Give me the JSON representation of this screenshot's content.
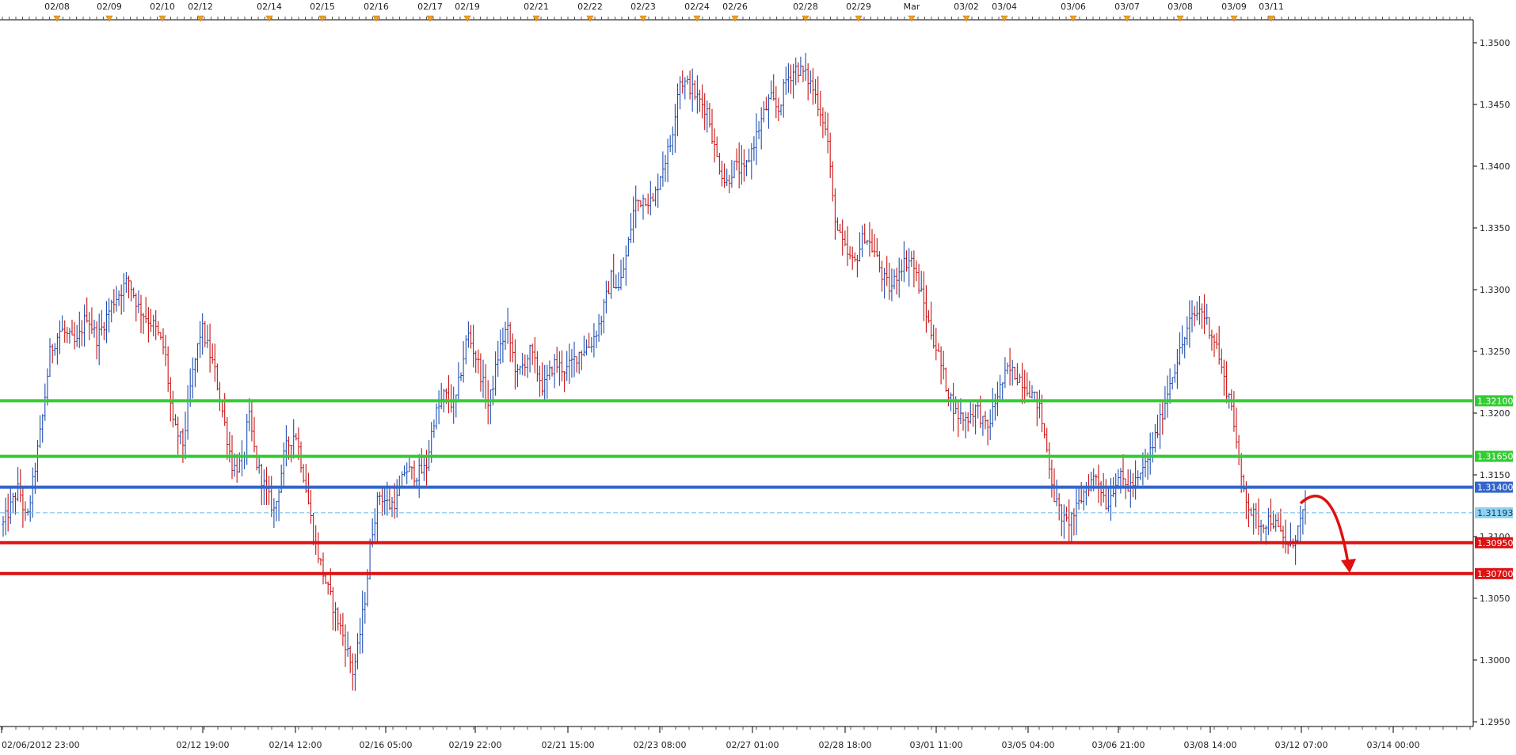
{
  "chart_data": {
    "type": "candlestick",
    "top_date_labels": [
      "02/08",
      "02/09",
      "02/10",
      "02/12",
      "02/14",
      "02/15",
      "02/16",
      "02/17",
      "02/19",
      "02/21",
      "02/22",
      "02/23",
      "02/24",
      "02/26",
      "02/28",
      "02/29",
      "Mar",
      "03/02",
      "03/04",
      "03/06",
      "03/07",
      "03/08",
      "03/09",
      "03/11"
    ],
    "x_tick_labels": [
      "02/06/2012 23:00",
      "02/12 19:00",
      "02/14 12:00",
      "02/16 05:00",
      "02/19 22:00",
      "02/21 15:00",
      "02/23 08:00",
      "02/27 01:00",
      "02/28 18:00",
      "03/01 11:00",
      "03/05 04:00",
      "03/06 21:00",
      "03/08 14:00",
      "03/12 07:00",
      "03/14 00:00"
    ],
    "y_ticks": [
      1.295,
      1.3,
      1.305,
      1.31,
      1.315,
      1.32,
      1.325,
      1.33,
      1.335,
      1.34,
      1.345,
      1.35
    ],
    "y_tick_labels": [
      "1.2950",
      "1.3000",
      "1.3050",
      "1.3100",
      "1.3150",
      "1.3200",
      "1.3250",
      "1.3300",
      "1.3350",
      "1.3400",
      "1.3450",
      "1.3500"
    ],
    "ylim": [
      1.2945,
      1.3503
    ],
    "grid": false,
    "current_price": {
      "value": 1.31193,
      "label": "1.31193",
      "color": "#8fd3f4"
    },
    "horizontal_levels": [
      {
        "value": 1.321,
        "label": "1.32100",
        "color": "#33cc33"
      },
      {
        "value": 1.3165,
        "label": "1.31650",
        "color": "#33cc33"
      },
      {
        "value": 1.314,
        "label": "1.31400",
        "color": "#3366cc"
      },
      {
        "value": 1.3095,
        "label": "1.30950",
        "color": "#dd1111"
      },
      {
        "value": 1.307,
        "label": "1.30700",
        "color": "#dd1111"
      }
    ],
    "price_path": [
      [
        0,
        1.311
      ],
      [
        6,
        1.314
      ],
      [
        9,
        1.311
      ],
      [
        15,
        1.3195
      ],
      [
        18,
        1.325
      ],
      [
        22,
        1.3268
      ],
      [
        28,
        1.3255
      ],
      [
        32,
        1.328
      ],
      [
        36,
        1.326
      ],
      [
        42,
        1.329
      ],
      [
        48,
        1.3308
      ],
      [
        52,
        1.3285
      ],
      [
        58,
        1.327
      ],
      [
        62,
        1.325
      ],
      [
        65,
        1.319
      ],
      [
        69,
        1.3175
      ],
      [
        72,
        1.3225
      ],
      [
        76,
        1.327
      ],
      [
        81,
        1.3235
      ],
      [
        85,
        1.319
      ],
      [
        88,
        1.3155
      ],
      [
        92,
        1.316
      ],
      [
        94,
        1.32
      ],
      [
        97,
        1.316
      ],
      [
        101,
        1.3135
      ],
      [
        104,
        1.312
      ],
      [
        108,
        1.317
      ],
      [
        112,
        1.3185
      ],
      [
        116,
        1.314
      ],
      [
        119,
        1.31
      ],
      [
        122,
        1.3075
      ],
      [
        124,
        1.306
      ],
      [
        127,
        1.304
      ],
      [
        131,
        1.3015
      ],
      [
        134,
        1.299
      ],
      [
        136,
        1.301
      ],
      [
        139,
        1.3055
      ],
      [
        141,
        1.31
      ],
      [
        144,
        1.3135
      ],
      [
        148,
        1.3125
      ],
      [
        151,
        1.313
      ],
      [
        154,
        1.3155
      ],
      [
        158,
        1.315
      ],
      [
        162,
        1.3155
      ],
      [
        165,
        1.3195
      ],
      [
        169,
        1.3215
      ],
      [
        173,
        1.3205
      ],
      [
        178,
        1.3265
      ],
      [
        182,
        1.324
      ],
      [
        186,
        1.3205
      ],
      [
        190,
        1.325
      ],
      [
        193,
        1.327
      ],
      [
        197,
        1.323
      ],
      [
        202,
        1.325
      ],
      [
        207,
        1.322
      ],
      [
        211,
        1.324
      ],
      [
        216,
        1.3235
      ],
      [
        221,
        1.325
      ],
      [
        225,
        1.3255
      ],
      [
        229,
        1.3275
      ],
      [
        233,
        1.331
      ],
      [
        236,
        1.33
      ],
      [
        239,
        1.333
      ],
      [
        242,
        1.337
      ],
      [
        246,
        1.3375
      ],
      [
        249,
        1.337
      ],
      [
        252,
        1.3395
      ],
      [
        256,
        1.342
      ],
      [
        259,
        1.347
      ],
      [
        263,
        1.3465
      ],
      [
        266,
        1.3455
      ],
      [
        270,
        1.3445
      ],
      [
        273,
        1.341
      ],
      [
        277,
        1.3385
      ],
      [
        280,
        1.34
      ],
      [
        284,
        1.3395
      ],
      [
        287,
        1.3415
      ],
      [
        291,
        1.344
      ],
      [
        294,
        1.3455
      ],
      [
        297,
        1.3445
      ],
      [
        300,
        1.347
      ],
      [
        304,
        1.348
      ],
      [
        307,
        1.3475
      ],
      [
        310,
        1.3465
      ],
      [
        314,
        1.344
      ],
      [
        316,
        1.342
      ],
      [
        318,
        1.337
      ],
      [
        320,
        1.3345
      ],
      [
        323,
        1.333
      ],
      [
        326,
        1.332
      ],
      [
        330,
        1.3345
      ],
      [
        334,
        1.333
      ],
      [
        337,
        1.331
      ],
      [
        340,
        1.33
      ],
      [
        344,
        1.332
      ],
      [
        348,
        1.3325
      ],
      [
        352,
        1.3295
      ],
      [
        355,
        1.327
      ],
      [
        358,
        1.325
      ],
      [
        361,
        1.3225
      ],
      [
        365,
        1.32
      ],
      [
        369,
        1.3195
      ],
      [
        373,
        1.3205
      ],
      [
        377,
        1.3185
      ],
      [
        381,
        1.3215
      ],
      [
        385,
        1.3235
      ],
      [
        389,
        1.323
      ],
      [
        393,
        1.322
      ],
      [
        397,
        1.3205
      ],
      [
        400,
        1.317
      ],
      [
        403,
        1.313
      ],
      [
        407,
        1.311
      ],
      [
        411,
        1.312
      ],
      [
        415,
        1.314
      ],
      [
        419,
        1.315
      ],
      [
        423,
        1.3125
      ],
      [
        427,
        1.315
      ],
      [
        431,
        1.314
      ],
      [
        435,
        1.3145
      ],
      [
        439,
        1.3165
      ],
      [
        443,
        1.319
      ],
      [
        447,
        1.3225
      ],
      [
        451,
        1.325
      ],
      [
        455,
        1.3275
      ],
      [
        459,
        1.3285
      ],
      [
        462,
        1.327
      ],
      [
        465,
        1.3255
      ],
      [
        468,
        1.3225
      ],
      [
        471,
        1.3205
      ],
      [
        474,
        1.315
      ],
      [
        478,
        1.312
      ],
      [
        482,
        1.311
      ],
      [
        486,
        1.3115
      ],
      [
        490,
        1.31
      ],
      [
        493,
        1.309
      ],
      [
        496,
        1.3105
      ],
      [
        499,
        1.3125
      ]
    ]
  }
}
